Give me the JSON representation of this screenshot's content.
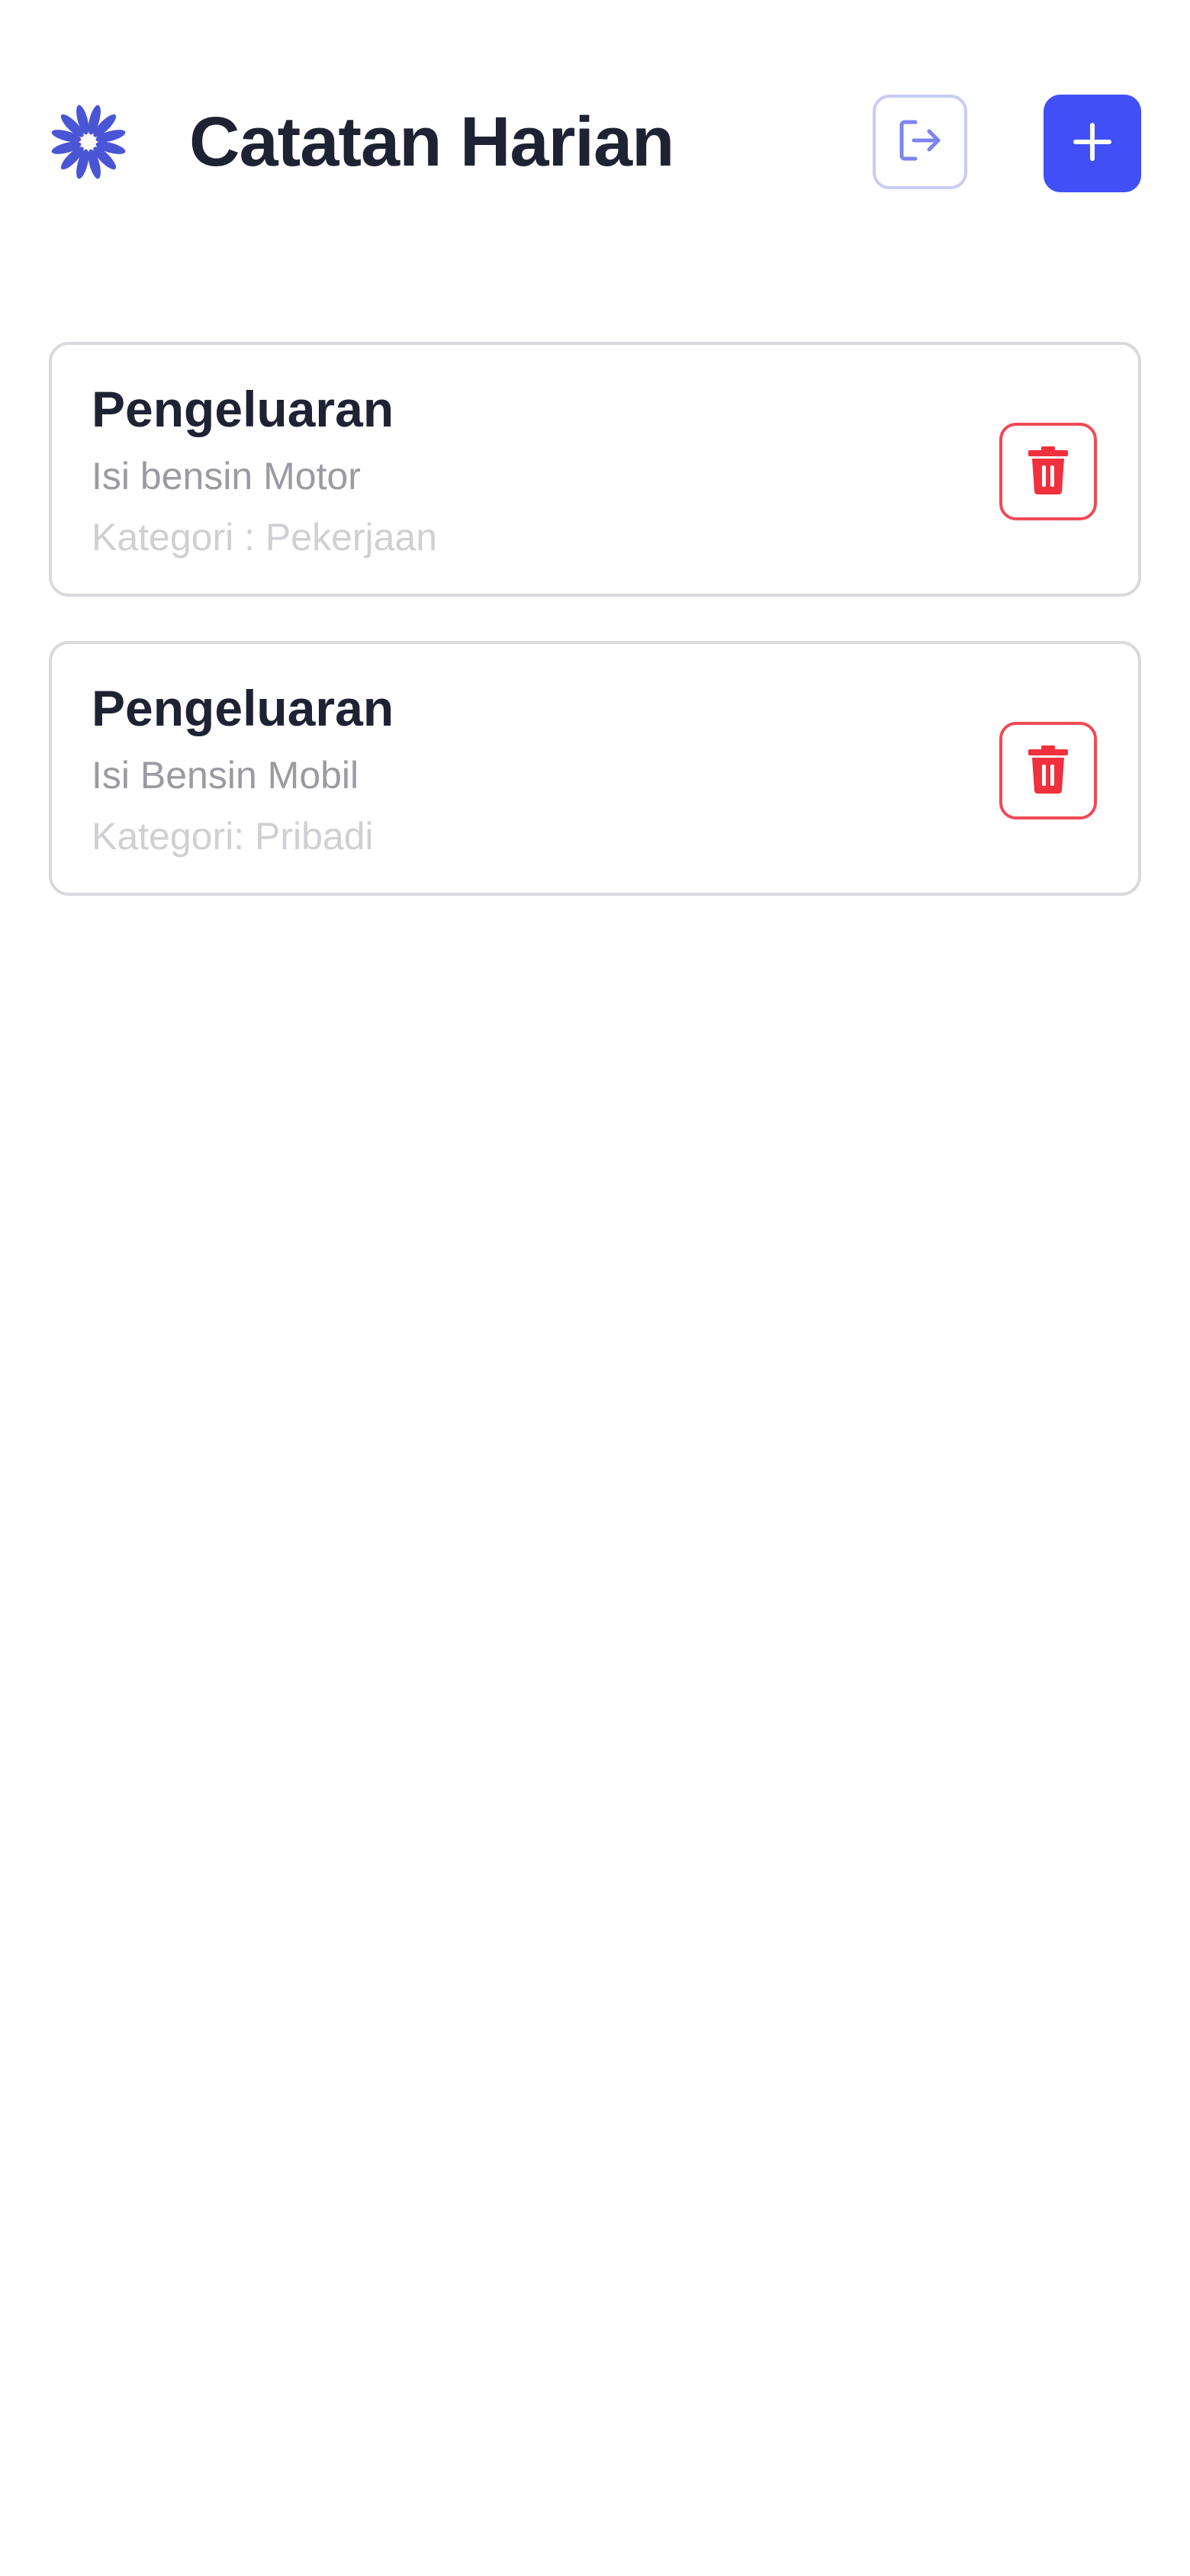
{
  "header": {
    "app_title": "Catatan Harian",
    "logo_icon": "flower-logo-icon",
    "logout_icon": "logout-icon",
    "add_icon": "plus-icon"
  },
  "notes": [
    {
      "title": "Pengeluaran",
      "description": "Isi bensin Motor",
      "category": "Kategori : Pekerjaan",
      "delete_icon": "trash-icon"
    },
    {
      "title": "Pengeluaran",
      "description": "Isi Bensin Mobil",
      "category": "Kategori: Pribadi",
      "delete_icon": "trash-icon"
    }
  ],
  "colors": {
    "primary": "#4050f6",
    "logout_border": "#c8ccf3",
    "logout_icon": "#7d84ef",
    "danger": "#f0303c",
    "danger_border": "#f04a55",
    "title_text": "#1e2333",
    "description_text": "#9a9aa2",
    "category_text": "#cfcfd4",
    "card_border": "#d9d9de",
    "logo": "#4a55d6"
  }
}
